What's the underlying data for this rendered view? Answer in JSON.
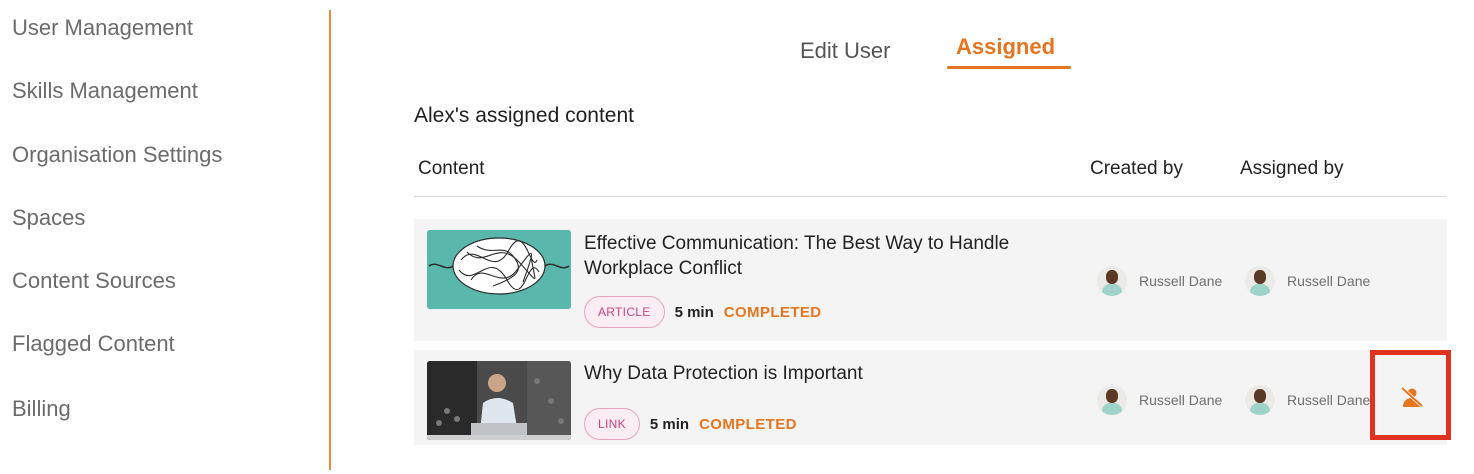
{
  "sidebar": {
    "items": [
      {
        "label": "User Management"
      },
      {
        "label": "Skills Management"
      },
      {
        "label": "Organisation Settings"
      },
      {
        "label": "Spaces"
      },
      {
        "label": "Content Sources"
      },
      {
        "label": "Flagged Content"
      },
      {
        "label": "Billing"
      }
    ]
  },
  "tabs": {
    "edit_user": "Edit User",
    "assigned": "Assigned",
    "active": "Assigned"
  },
  "section": {
    "title": "Alex's assigned content"
  },
  "table": {
    "headers": {
      "content": "Content",
      "created_by": "Created by",
      "assigned_by": "Assigned by"
    },
    "rows": [
      {
        "title": "Effective Communication: The Best Way to Handle Workplace Conflict",
        "type": "ARTICLE",
        "duration": "5 min",
        "status": "COMPLETED",
        "created_by": "Russell Dane",
        "assigned_by": "Russell Dane"
      },
      {
        "title": "Why Data Protection is Important",
        "type": "LINK",
        "duration": "5 min",
        "status": "COMPLETED",
        "created_by": "Russell Dane",
        "assigned_by": "Russell Dane"
      }
    ]
  },
  "icons": {
    "unassign": "unassign-user-icon"
  },
  "colors": {
    "accent": "#e5751e",
    "highlight_box": "#e0331f",
    "pill_text": "#c0487f"
  }
}
